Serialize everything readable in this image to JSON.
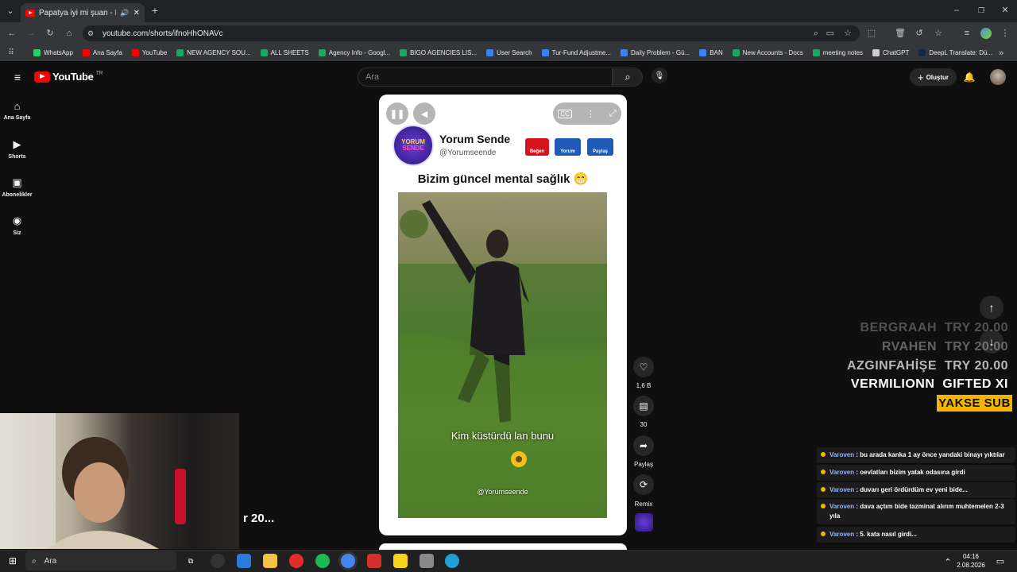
{
  "browser": {
    "tab_title": "Papatya iyi mi şuan - Komik",
    "url": "youtube.com/shorts/ifnoHhONAVc",
    "bookmarks": [
      {
        "label": "WhatsApp",
        "color": "#25d366"
      },
      {
        "label": "Ana Sayfa",
        "color": "#ff0000"
      },
      {
        "label": "YouTube",
        "color": "#ff0000"
      },
      {
        "label": "NEW AGENCY SOU...",
        "color": "#1fa463"
      },
      {
        "label": "ALL SHEETS",
        "color": "#1fa463"
      },
      {
        "label": "Agency Info - Googl...",
        "color": "#1fa463"
      },
      {
        "label": "BIGO AGENCIES LIS...",
        "color": "#1fa463"
      },
      {
        "label": "User Search",
        "color": "#3b82f6"
      },
      {
        "label": "Tur-Fund Adjustme...",
        "color": "#3b82f6"
      },
      {
        "label": "Daily Problem - Gü...",
        "color": "#3b82f6"
      },
      {
        "label": "BAN",
        "color": "#3b82f6"
      },
      {
        "label": "New Accounts - Docs",
        "color": "#1fa463"
      },
      {
        "label": "meeting notes",
        "color": "#1fa463"
      },
      {
        "label": "ChatGPT",
        "color": "#cccccc"
      },
      {
        "label": "DeepL Translate: Dü...",
        "color": "#0f2b46"
      }
    ]
  },
  "youtube": {
    "logo_text": "YouTube",
    "region": "TR",
    "search_placeholder": "Ara",
    "create_label": "Oluştur",
    "nav": [
      {
        "label": "Ana Sayfa",
        "icon": "home-icon"
      },
      {
        "label": "Shorts",
        "icon": "shorts-icon"
      },
      {
        "label": "Abonelikler",
        "icon": "subscriptions-icon"
      },
      {
        "label": "Siz",
        "icon": "you-icon"
      }
    ]
  },
  "short": {
    "channel_name": "Yorum Sende",
    "channel_handle": "@Yorumseende",
    "badges": [
      "Beğen",
      "Yorum",
      "Paylaş"
    ],
    "caption_title": "Bizim güncel mental sağlık 😁",
    "video_subtitle": "Kim küstürdü lan bunu",
    "video_watermark": "@Yorumseende",
    "likes": "1,6 B",
    "comments": "30",
    "share_label": "Paylaş",
    "remix_label": "Remix"
  },
  "overlay": {
    "donations": [
      {
        "name": "BERGRAAH",
        "amount": "TRY 20.00"
      },
      {
        "name": "RVAHEN",
        "amount": "TRY 20.00"
      },
      {
        "name": "AZGINFAHİŞE",
        "amount": "TRY 20.00"
      },
      {
        "name": "VERMILIONN",
        "amount": "GIFTED XI"
      }
    ],
    "sub_banner": "YAKSE SUB",
    "cam_text": "r 20...",
    "chat": [
      {
        "user": "Varoven",
        "msg": "bu arada kanka 1 ay önce yandaki binayı yıktılar"
      },
      {
        "user": "Varoven",
        "msg": "oevlatları bizim yatak odasına girdi"
      },
      {
        "user": "Varoven",
        "msg": "duvarı geri ördürdüm ev yeni bide..."
      },
      {
        "user": "Varoven",
        "msg": "dava açtım bide tazminat alırım muhtemelen 2-3 yıla"
      },
      {
        "user": "Varoven",
        "msg": "5. kata nasıl girdi..."
      }
    ]
  },
  "taskbar": {
    "search_label": "Ara",
    "time": "04:16",
    "date": "2.08.2026"
  }
}
